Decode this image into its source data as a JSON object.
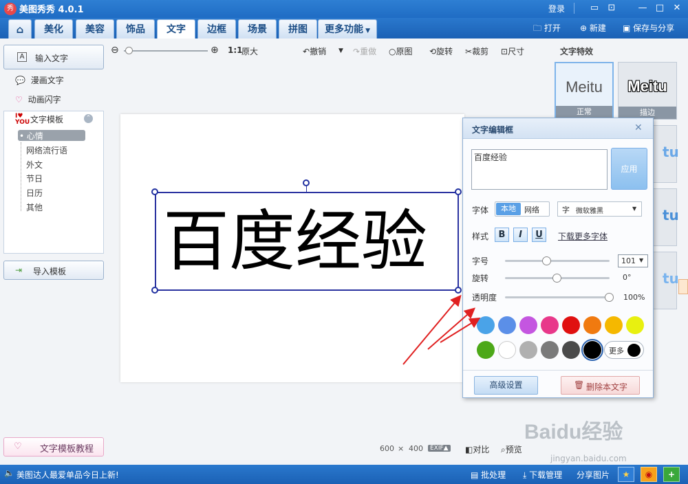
{
  "app": {
    "title": "美图秀秀 4.0.1",
    "logo_char": "秀",
    "login": "登录"
  },
  "tabs": [
    {
      "label": "美化"
    },
    {
      "label": "美容"
    },
    {
      "label": "饰品"
    },
    {
      "label": "文字"
    },
    {
      "label": "边框"
    },
    {
      "label": "场景"
    },
    {
      "label": "拼图"
    },
    {
      "label": "更多功能"
    }
  ],
  "top_actions": {
    "open": "打开",
    "new": "新建",
    "save": "保存与分享"
  },
  "left": {
    "input_text": "输入文字",
    "comic_text": "漫画文字",
    "animated_text": "动画闪字",
    "template_title": "文字模板",
    "template_items": [
      "心情",
      "网络流行语",
      "外文",
      "节日",
      "日历",
      "其他"
    ],
    "import_template": "导入模板",
    "tutorial": "文字模板教程"
  },
  "toolbar": {
    "ratio": "1:1",
    "original_size": "原大",
    "undo": "撤销",
    "redo": "重做",
    "original": "原图",
    "rotate": "旋转",
    "crop": "裁剪",
    "size": "尺寸"
  },
  "canvas": {
    "text": "百度经验",
    "width": "600",
    "x_sign": "×",
    "height": "400",
    "exif": "EXIF▲",
    "compare": "对比",
    "preview": "预览"
  },
  "dialog": {
    "title": "文字编辑框",
    "text_value": "百度经验",
    "apply": "应用",
    "font_label": "字体",
    "font_local": "本地",
    "font_web": "网络",
    "font_name": "微软雅黑",
    "style_label": "样式",
    "bold": "B",
    "italic": "I",
    "underline": "U",
    "download_fonts": "下载更多字体",
    "size_label": "字号",
    "size_value": "101",
    "size_level": 0.4,
    "rotate_label": "旋转",
    "rotate_value": "0°",
    "rotate_level": 0.5,
    "opacity_label": "透明度",
    "opacity_value": "100%",
    "opacity_level": 1.0,
    "colors": [
      "#4aa3e8",
      "#5b8fe8",
      "#c456e0",
      "#e8388a",
      "#e01010",
      "#f07a10",
      "#f5b800",
      "#e8f010",
      "#4ca818",
      "#ffffff",
      "#b0b0b0",
      "#7a7a7a",
      "#4a4a4a",
      "#000000"
    ],
    "more_colors": "更多",
    "advanced": "高级设置",
    "delete_text": "删除本文字"
  },
  "right": {
    "title": "文字特效",
    "effects": [
      {
        "preview": "Meitu",
        "label": "正常"
      },
      {
        "preview": "Meitu",
        "label": "描边"
      }
    ]
  },
  "status": {
    "message": "美图达人最爱单品今日上新!",
    "batch": "批处理",
    "download_mgr": "下载管理",
    "share": "分享图片"
  },
  "watermark": {
    "brand": "Baidu经验",
    "url": "jingyan.baidu.com"
  },
  "accent_color": "#1f6cc4"
}
